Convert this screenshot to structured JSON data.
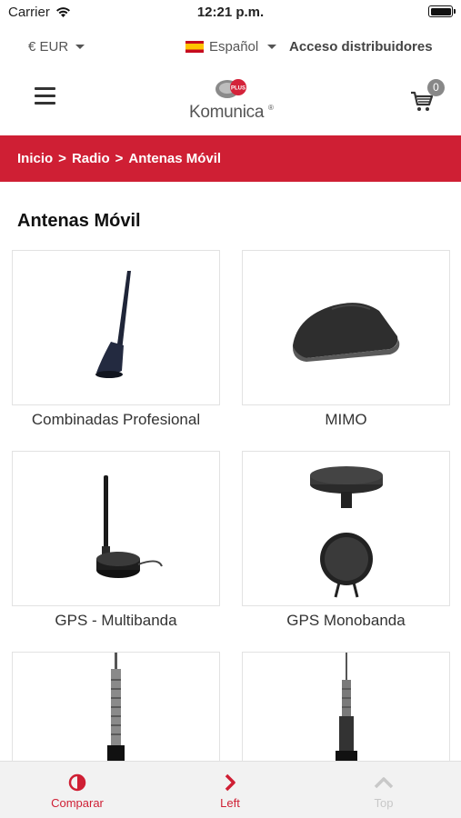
{
  "status": {
    "carrier": "Carrier",
    "time": "12:21 p.m."
  },
  "topbar": {
    "currency": "€ EUR",
    "language": "Español",
    "distributors": "Acceso distribuidores"
  },
  "header": {
    "logo_text": "Komunica",
    "cart_count": "0",
    "logo_badge": "PLUS"
  },
  "breadcrumb": {
    "items": [
      "Inicio",
      ">",
      "Radio",
      ">",
      "Antenas Móvil"
    ]
  },
  "page": {
    "title": "Antenas Móvil"
  },
  "products": [
    {
      "label": "Combinadas Profesional"
    },
    {
      "label": "MIMO"
    },
    {
      "label": "GPS - Multibanda"
    },
    {
      "label": "GPS Monobanda"
    },
    {
      "label": ""
    },
    {
      "label": ""
    }
  ],
  "bottom_nav": {
    "compare": "Comparar",
    "left": "Left",
    "top": "Top"
  },
  "colors": {
    "brand_red": "#cf1f34",
    "text": "#333333",
    "inactive": "#c8c8c8"
  }
}
